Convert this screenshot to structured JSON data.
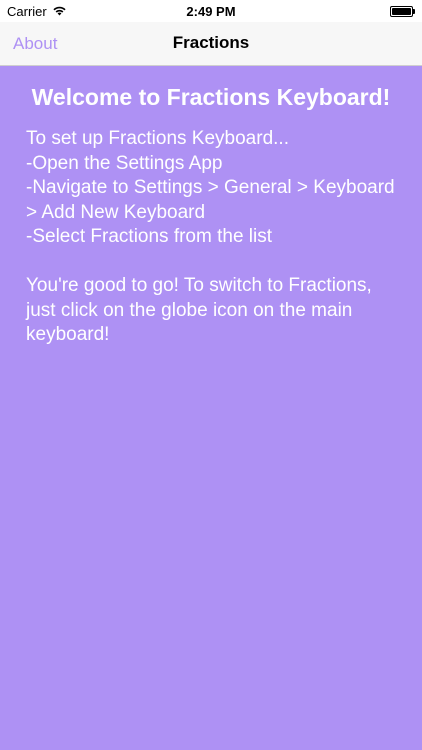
{
  "status_bar": {
    "carrier": "Carrier",
    "time": "2:49 PM"
  },
  "nav": {
    "back_label": "About",
    "title": "Fractions"
  },
  "main": {
    "heading": "Welcome to Fractions Keyboard!",
    "instructions": [
      "To set up Fractions Keyboard...",
      "-Open the Settings App",
      "-Navigate to Settings > General > Keyboard > Add New Keyboard",
      "-Select Fractions from the list"
    ],
    "closing": "You're good to go! To switch to Fractions, just click on the globe icon on the main keyboard!"
  },
  "colors": {
    "background": "#ae91f4",
    "accent": "#ae91f4",
    "text": "#ffffff"
  },
  "icons": {
    "wifi": "wifi-icon",
    "battery": "battery-icon"
  }
}
